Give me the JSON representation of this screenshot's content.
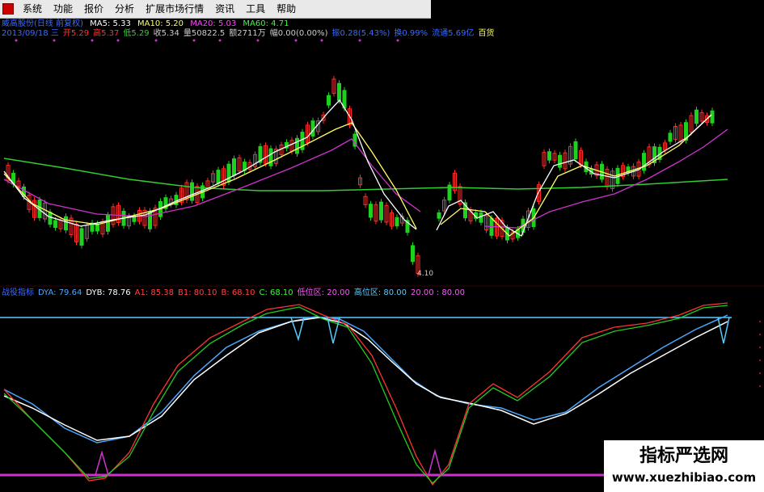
{
  "menu": {
    "items": [
      "系统",
      "功能",
      "报价",
      "分析",
      "扩展市场行情",
      "资讯",
      "工具",
      "帮助"
    ]
  },
  "main_header": {
    "indicator_name": "威高股份(日线 前复权)",
    "ma": [
      {
        "label": "MA5: 5.33",
        "color": "#ffffff"
      },
      {
        "label": "MA10: 5.20",
        "color": "#ffff66"
      },
      {
        "label": "MA20: 5.03",
        "color": "#ff44ff"
      },
      {
        "label": "MA60: 4.71",
        "color": "#33ff33"
      }
    ]
  },
  "quote_bar": {
    "items": [
      {
        "text": "2013/09/18 三",
        "color": "#3a6aff"
      },
      {
        "text": "开5.29",
        "color": "#ff3333"
      },
      {
        "text": "高5.37",
        "color": "#ff3333"
      },
      {
        "text": "低5.29",
        "color": "#33cc33"
      },
      {
        "text": "收5.34",
        "color": "#cccccc"
      },
      {
        "text": "量50822.5",
        "color": "#cccccc"
      },
      {
        "text": "额2711万",
        "color": "#cccccc"
      },
      {
        "text": "幅0.00(0.00%)",
        "color": "#cccccc"
      },
      {
        "text": "振0.28(5.43%)",
        "color": "#3a6aff"
      },
      {
        "text": "换0.99%",
        "color": "#3a6aff"
      },
      {
        "text": "流通5.69亿",
        "color": "#3a6aff"
      },
      {
        "text": "百货",
        "color": "#ffff55"
      }
    ]
  },
  "sub_header": {
    "items": [
      {
        "text": "战役指标",
        "color": "#3a6aff"
      },
      {
        "text": "DYA: 79.64",
        "color": "#4aa8ff"
      },
      {
        "text": "DYB: 78.76",
        "color": "#ffffff"
      },
      {
        "text": "A1: 85.38",
        "color": "#ff4444"
      },
      {
        "text": "B1: 80.10",
        "color": "#ff4444"
      },
      {
        "text": "B: 68.10",
        "color": "#ff4444"
      },
      {
        "text": "C: 68.10",
        "color": "#33ff33"
      },
      {
        "text": "低位区: 20.00",
        "color": "#ff55ff"
      },
      {
        "text": "高位区: 80.00",
        "color": "#55ccff"
      },
      {
        "text": "20.00 : 80.00",
        "color": "#ff55ff"
      }
    ]
  },
  "low_price_tag": "4.10",
  "watermark": {
    "title": "指标严选网",
    "url": "www.xuezhibiao.com"
  },
  "colors": {
    "up": "#ff2a2a",
    "down": "#1fd11f",
    "ma5": "#ffffff",
    "ma10": "#ffff66",
    "ma20": "#cc33cc",
    "ma60": "#33cc33",
    "dya": "#4aa8ff",
    "dyb": "#ffffff",
    "line_red": "#ff3333",
    "line_green": "#22cc22",
    "high_zone": "#55ccff",
    "low_zone": "#cc33cc"
  }
}
